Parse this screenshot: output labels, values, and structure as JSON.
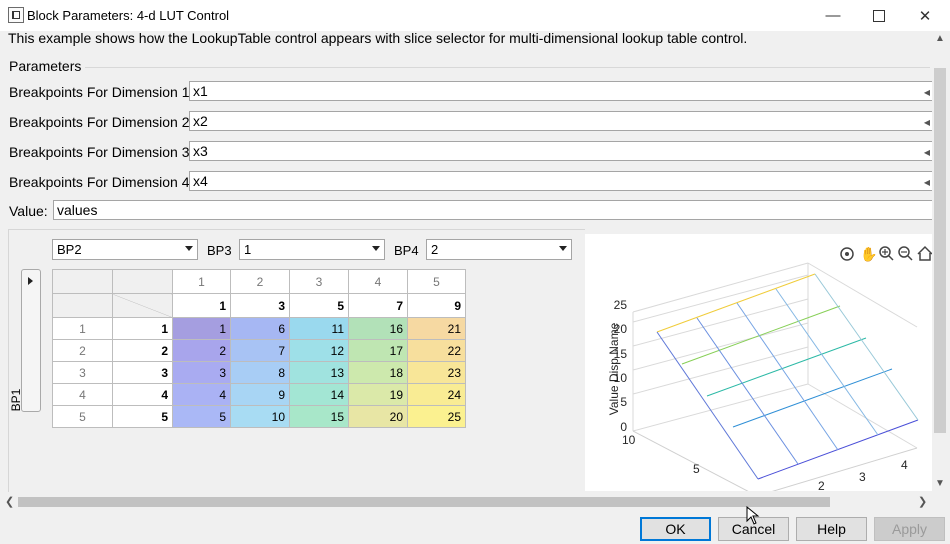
{
  "window": {
    "title": "Block Parameters: 4-d LUT Control"
  },
  "description": "This example shows how the LookupTable control appears with slice selector for multi-dimensional lookup table control.",
  "parameters": {
    "group_label": "Parameters",
    "rows": [
      {
        "label": "Breakpoints For Dimension 1 :",
        "value": "x1"
      },
      {
        "label": "Breakpoints For Dimension 2 :",
        "value": "x2"
      },
      {
        "label": "Breakpoints For Dimension 3 :",
        "value": "x3"
      },
      {
        "label": "Breakpoints For Dimension 4 :",
        "value": "x4"
      }
    ],
    "value_label": "Value:",
    "value": "values"
  },
  "lut": {
    "selectors": {
      "first": {
        "value": "BP2"
      },
      "bp3": {
        "label": "BP3",
        "value": "1"
      },
      "bp4": {
        "label": "BP4",
        "value": "2"
      }
    },
    "bp1_label": "BP1",
    "col_indices": [
      "1",
      "2",
      "3",
      "4",
      "5"
    ],
    "col_breakpoints": [
      "1",
      "3",
      "5",
      "7",
      "9"
    ],
    "row_indices": [
      "1",
      "2",
      "3",
      "4",
      "5"
    ],
    "row_breakpoints": [
      "1",
      "2",
      "3",
      "4",
      "5"
    ],
    "values": [
      [
        "1",
        "6",
        "11",
        "16",
        "21"
      ],
      [
        "2",
        "7",
        "12",
        "17",
        "22"
      ],
      [
        "3",
        "8",
        "13",
        "18",
        "23"
      ],
      [
        "4",
        "9",
        "14",
        "19",
        "24"
      ],
      [
        "5",
        "10",
        "15",
        "20",
        "25"
      ]
    ],
    "colors": [
      [
        "#a59ee0",
        "#a6b7f3",
        "#9ad9ee",
        "#b2e1b8",
        "#f6d9a2"
      ],
      [
        "#a8a5ec",
        "#a8c3f4",
        "#9ee0e8",
        "#bfe6b2",
        "#f7df9d"
      ],
      [
        "#a9abf1",
        "#a8cdf5",
        "#a0e3df",
        "#cde9ad",
        "#f8e698"
      ],
      [
        "#aab2f4",
        "#a8d5f4",
        "#a3e6d4",
        "#dbe9a9",
        "#f9ec94"
      ],
      [
        "#aab8f6",
        "#a8dcf3",
        "#a8e7c9",
        "#e8e6a5",
        "#fbf190"
      ]
    ]
  },
  "plot": {
    "zlabel": "Value Disp Name",
    "z_ticks": [
      "25",
      "20",
      "15",
      "10",
      "5",
      "0"
    ],
    "y_ticks": [
      "10",
      "5"
    ],
    "x_ticks": [
      "2",
      "3",
      "4"
    ]
  },
  "buttons": {
    "ok": "OK",
    "cancel": "Cancel",
    "help": "Help",
    "apply": "Apply"
  }
}
